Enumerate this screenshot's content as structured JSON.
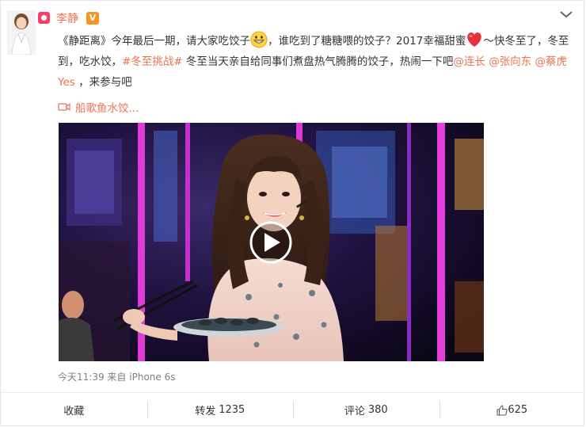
{
  "user": {
    "name": "李静",
    "vip_badge": "V"
  },
  "post": {
    "parts": [
      "《静距离》今年最后一期，请大家吃饺子",
      "，谁吃到了糖糖喂的饺子？2017幸福甜蜜",
      "～快冬至了，冬至到，吃水饺，",
      "#冬至挑战#",
      " 冬至当天亲自给同事们煮盘热气腾腾的饺子，热闹一下吧",
      "@连长",
      " ",
      "@张向东",
      " ",
      "@蔡虎Yes",
      " ，来参与吧"
    ]
  },
  "video": {
    "link_label": "船歌鱼水饺..."
  },
  "meta": {
    "time": "今天11:39",
    "from_prefix": "来自",
    "source": "iPhone 6s"
  },
  "actions": {
    "collect": "收藏",
    "repost_label": "转发",
    "repost_count": "1235",
    "comment_label": "评论",
    "comment_count": "380",
    "like_count": "625"
  },
  "colors": {
    "accent": "#eb7350",
    "text": "#333333",
    "muted": "#808080"
  },
  "icons": [
    "chevron-down-icon",
    "weibo-app-icon",
    "vip-icon",
    "grin-emoji-icon",
    "heart-emoji-icon",
    "video-camera-icon",
    "play-icon",
    "thumbs-up-icon"
  ]
}
